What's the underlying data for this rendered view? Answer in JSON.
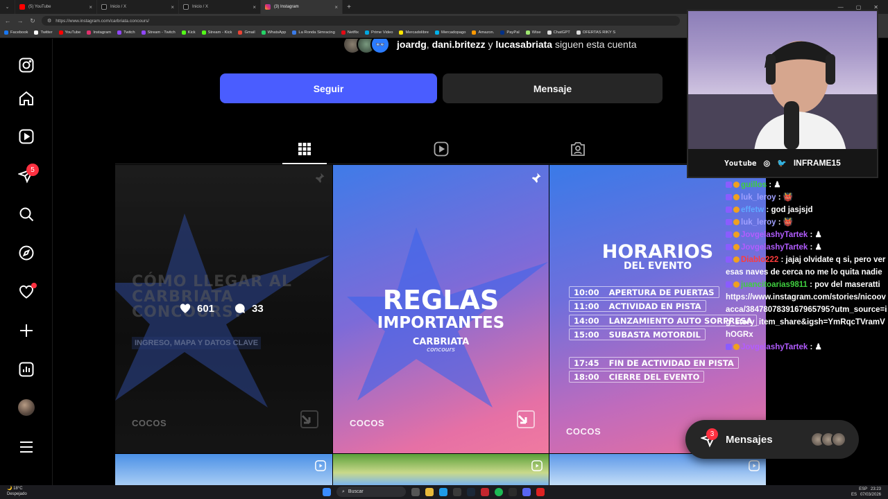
{
  "browser": {
    "tabs": [
      {
        "title": "(5) YouTube",
        "color": "#ff0000",
        "active": false
      },
      {
        "title": "Inicio / X",
        "color": "#ffffff",
        "active": false
      },
      {
        "title": "Inicio / X",
        "color": "#ffffff",
        "active": false
      },
      {
        "title": "(3) Instagram",
        "color": "#e1306c",
        "active": true
      }
    ],
    "url": "https://www.instagram.com/carbriata.concours/",
    "bookmarks": [
      {
        "label": "Facebook",
        "color": "#1877f2"
      },
      {
        "label": "Twitter",
        "color": "#ffffff"
      },
      {
        "label": "YouTube",
        "color": "#ff0000"
      },
      {
        "label": "Instagram",
        "color": "#e1306c"
      },
      {
        "label": "Twitch",
        "color": "#9146ff"
      },
      {
        "label": "Stream - Twitch",
        "color": "#9146ff"
      },
      {
        "label": "Kick",
        "color": "#53fc18"
      },
      {
        "label": "Stream - Kick",
        "color": "#53fc18"
      },
      {
        "label": "Gmail",
        "color": "#ea4335"
      },
      {
        "label": "WhatsApp",
        "color": "#25d366"
      },
      {
        "label": "La Ronda Simracing",
        "color": "#3a7be8"
      },
      {
        "label": "Netflix",
        "color": "#e50914"
      },
      {
        "label": "Prime Video",
        "color": "#00a8e1"
      },
      {
        "label": "Mercadolibre",
        "color": "#ffe600"
      },
      {
        "label": "Mercadopago",
        "color": "#00b1ea"
      },
      {
        "label": "Amazon.",
        "color": "#ff9900"
      },
      {
        "label": "PayPal",
        "color": "#003087"
      },
      {
        "label": "Wise",
        "color": "#9fe870"
      },
      {
        "label": "ChatGPT",
        "color": "#dddddd"
      },
      {
        "label": "OFERTAS RIKY S",
        "color": "#dddddd"
      }
    ]
  },
  "profile": {
    "followed_by_names": [
      "joardg",
      "dani.britezz",
      "lucasabriata"
    ],
    "followed_by_joiner_1": ", ",
    "followed_by_joiner_2": " y ",
    "followed_by_suffix": " siguen esta cuenta",
    "follow_label": "Seguir",
    "message_label": "Mensaje"
  },
  "nav": {
    "notifications_badge": "5"
  },
  "posts": {
    "p1": {
      "title": "CÓMO LLEGAR AL CARBRIATA CONCOURS?",
      "subtitle": "INGRESO, MAPA Y DATOS CLAVE",
      "likes": "601",
      "comments": "33",
      "brand": "COCOS"
    },
    "p2": {
      "title_line1": "REGLAS",
      "title_line2": "IMPORTANTES",
      "brand_name": "CARBRIATA",
      "brand_sub": "concours",
      "brand": "COCOS"
    },
    "p3": {
      "title_line1": "HORARIOS",
      "title_line2": "DEL EVENTO",
      "schedule": [
        {
          "time": "10:00",
          "event": "APERTURA DE PUERTAS"
        },
        {
          "time": "11:00",
          "event": "ACTIVIDAD EN PISTA"
        },
        {
          "time": "14:00",
          "event": "LANZAMIENTO AUTO SORPRESA"
        },
        {
          "time": "15:00",
          "event": "SUBASTA MOTORDIL"
        },
        {
          "time": "17:45",
          "event": "FIN DE ACTIVIDAD EN PISTA"
        },
        {
          "time": "18:00",
          "event": "CIERRE DEL EVENTO"
        }
      ],
      "brand": "COCOS"
    }
  },
  "stream": {
    "platform": "Youtube",
    "channel": "INFRAME15",
    "chat": [
      {
        "user": "guillos",
        "text": " : ♟",
        "color": "#3fcf3f"
      },
      {
        "user": "luk_leroy",
        "text": " : 👹",
        "color": "#a0a0ff"
      },
      {
        "user": "effetw",
        "text": " : god jasjsjd",
        "color": "#5fa8ff"
      },
      {
        "user": "luk_leroy",
        "text": " : 👹",
        "color": "#a0a0ff"
      },
      {
        "user": "JovgelashyTartek",
        "text": " : ♟",
        "color": "#b25cff"
      },
      {
        "user": "JovgelashyTartek",
        "text": " : ♟",
        "color": "#b25cff"
      },
      {
        "user": "Diablo222",
        "text": " : jajaj olvidate q si, pero ver esas naves de cerca no me lo quita nadie",
        "color": "#ff3b3b"
      },
      {
        "user": "juancitoarias9811",
        "text": " : pov del maseratti",
        "color": "#3fcf3f"
      },
      {
        "user": "",
        "text": "https://www.instagram.com/stories/nicoovacca/3847807839167965795?utm_source=ig_story_item_share&igsh=YmRqcTVramVhOGRx",
        "color": "#ffffff"
      },
      {
        "user": "JovgelashyTartek",
        "text": " : ♟",
        "color": "#b25cff"
      }
    ]
  },
  "messages_bubble": {
    "label": "Mensajes",
    "count": "3"
  },
  "taskbar": {
    "temp": "18°C",
    "weather": "Despejado",
    "search": "Buscar",
    "lang": "ESP",
    "region": "ES",
    "time": "23:23",
    "date": "07/03/2026"
  }
}
